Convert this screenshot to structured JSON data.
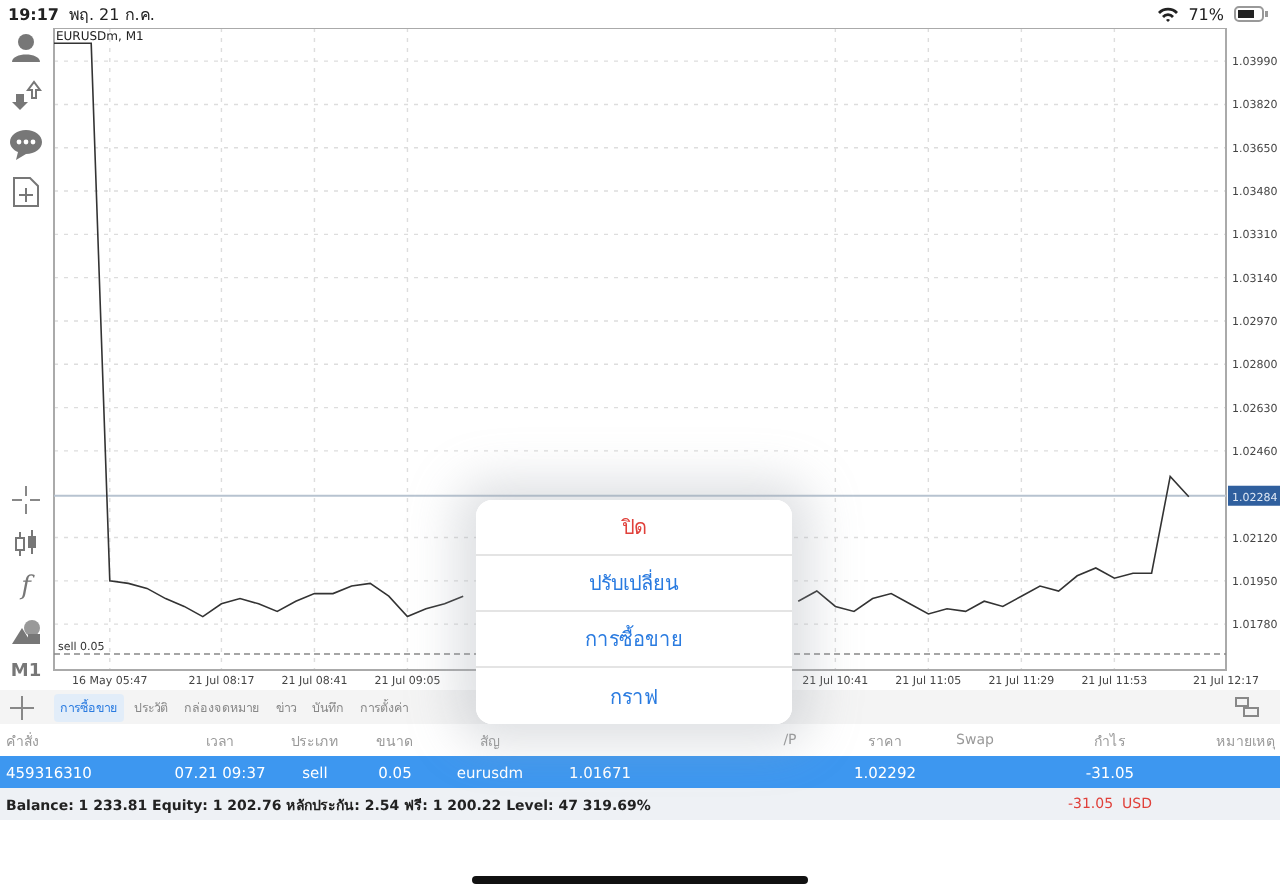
{
  "status_bar": {
    "time": "19:17",
    "date": "พฤ. 21 ก.ค.",
    "battery": "71%"
  },
  "chart": {
    "title": "EURUSDm, M1",
    "chart_data": {
      "type": "line",
      "grid": true,
      "ylim": [
        1.016,
        1.0412
      ],
      "categories": [
        null,
        null,
        null,
        "16 May 05:47",
        null,
        null,
        null,
        null,
        null,
        "21 Jul 08:17",
        null,
        null,
        null,
        null,
        "21 Jul 08:41",
        null,
        null,
        null,
        null,
        "21 Jul 09:05",
        null,
        null,
        null,
        null,
        null,
        null,
        null,
        null,
        null,
        null,
        null,
        null,
        null,
        null,
        null,
        null,
        null,
        null,
        null,
        null,
        null,
        null,
        "21 Jul 10:41",
        null,
        null,
        null,
        null,
        "21 Jul 11:05",
        null,
        null,
        null,
        null,
        "21 Jul 11:29",
        null,
        null,
        null,
        null,
        "21 Jul 11:53",
        null,
        null,
        null,
        null,
        null,
        "21 Jul 12:17"
      ],
      "yticks": [
        {
          "value": 1.0399,
          "label": "1.03990"
        },
        {
          "value": 1.0382,
          "label": "1.03820"
        },
        {
          "value": 1.0365,
          "label": "1.03650"
        },
        {
          "value": 1.0348,
          "label": "1.03480"
        },
        {
          "value": 1.0331,
          "label": "1.03310"
        },
        {
          "value": 1.0314,
          "label": "1.03140"
        },
        {
          "value": 1.0297,
          "label": "1.02970"
        },
        {
          "value": 1.028,
          "label": "1.02800"
        },
        {
          "value": 1.0263,
          "label": "1.02630"
        },
        {
          "value": 1.0246,
          "label": "1.02460"
        },
        {
          "value": 1.0212,
          "label": "1.02120"
        },
        {
          "value": 1.0195,
          "label": "1.01950"
        },
        {
          "value": 1.0178,
          "label": "1.01780"
        }
      ],
      "ref_lines": [
        {
          "axis": "y",
          "value": 1.02284,
          "label": "1.02284",
          "color": "#b7c3d0"
        },
        {
          "axis": "y",
          "value": 1.01663,
          "label": "sell 0.05",
          "color": "#888888"
        }
      ],
      "series": [
        {
          "color": "#333333",
          "values": [
            1.0406,
            1.0406,
            1.0406,
            1.0195,
            1.0194,
            1.0192,
            1.0188,
            1.0185,
            1.0181,
            1.0186,
            1.0188,
            1.0186,
            1.0183,
            1.0187,
            1.019,
            1.019,
            1.0193,
            1.0194,
            1.0189,
            1.0181,
            1.0184,
            1.0186,
            1.0189,
            null,
            null,
            null,
            null,
            null,
            null,
            null,
            null,
            null,
            null,
            null,
            null,
            null,
            null,
            null,
            null,
            null,
            1.0187,
            1.0191,
            1.0185,
            1.0183,
            1.0188,
            1.019,
            1.0186,
            1.0182,
            1.0184,
            1.0183,
            1.0187,
            1.0185,
            1.0189,
            1.0193,
            1.0191,
            1.0197,
            1.02,
            1.0196,
            1.0198,
            1.0198,
            1.0236,
            1.0228,
            null,
            null
          ]
        }
      ]
    }
  },
  "sidebar": {
    "function_glyph": "f",
    "timeframe": "M1"
  },
  "tabs": [
    {
      "label": "การซื้อขาย",
      "selected": true
    },
    {
      "label": "ประวัติ",
      "selected": false
    },
    {
      "label": "กล่องจดหมาย",
      "selected": false
    },
    {
      "label": "ข่าว",
      "selected": false
    },
    {
      "label": "บันทึก",
      "selected": false
    },
    {
      "label": "การตั้งค่า",
      "selected": false
    }
  ],
  "table": {
    "columns": [
      "คำสั่ง",
      "เวลา",
      "ประเภท",
      "ขนาด",
      "สัญ",
      "/P",
      "ราคา",
      "Swap",
      "กำไร",
      "หมายเหตุ"
    ],
    "rows": [
      {
        "selected": true,
        "open_price": "1.01671",
        "cells": [
          "459316310",
          "07.21 09:37",
          "sell",
          "0.05",
          "eurusdm",
          "",
          "1.02292",
          "",
          "-31.05",
          ""
        ]
      }
    ]
  },
  "summary": {
    "text": "Balance: 1 233.81 Equity: 1 202.76 หลักประกัน: 2.54 ฟรี: 1 200.22 Level: 47 319.69%",
    "profit": "-31.05",
    "currency": "USD"
  },
  "context_menu": [
    {
      "label": "ปิด",
      "kind": "destructive"
    },
    {
      "label": "ปรับเปลี่ยน",
      "kind": "action"
    },
    {
      "label": "การซื้อขาย",
      "kind": "action"
    },
    {
      "label": "กราฟ",
      "kind": "action"
    }
  ]
}
